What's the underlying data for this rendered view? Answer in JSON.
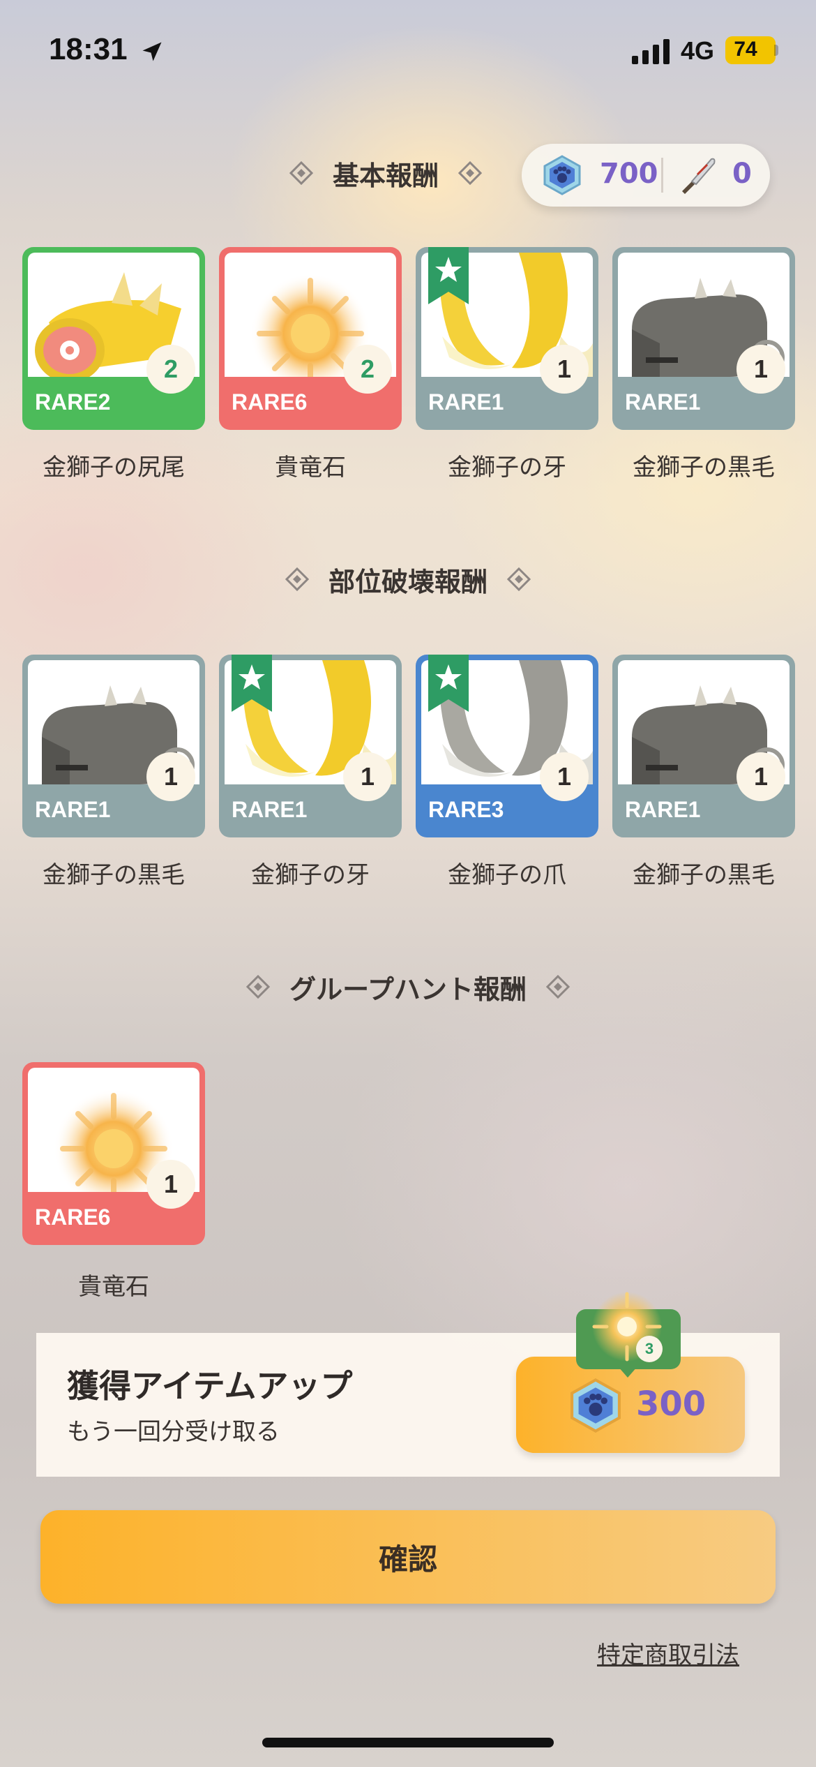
{
  "status_bar": {
    "time": "18:31",
    "network": "4G",
    "battery": "74"
  },
  "currency": {
    "gems": "700",
    "knives": "0"
  },
  "sections": {
    "basic": {
      "title": "基本報酬"
    },
    "part_break": {
      "title": "部位破壊報酬"
    },
    "group_hunt": {
      "title": "グループハント報酬"
    }
  },
  "rewards": {
    "basic": [
      {
        "rarity": "RARE2",
        "count": "2",
        "name": "金獅子の尻尾",
        "color": "#4cbb5a",
        "icon": "tail-icon"
      },
      {
        "rarity": "RARE6",
        "count": "2",
        "name": "貴竜石",
        "color": "#f06e6c",
        "icon": "sun-stone-icon"
      },
      {
        "rarity": "RARE1",
        "count": "1",
        "name": "金獅子の牙",
        "color": "#8fa6a8",
        "icon": "fang-icon"
      },
      {
        "rarity": "RARE1",
        "count": "1",
        "name": "金獅子の黒毛",
        "color": "#8fa6a8",
        "icon": "black-fur-icon"
      }
    ],
    "part_break": [
      {
        "rarity": "RARE1",
        "count": "1",
        "name": "金獅子の黒毛",
        "color": "#8fa6a8",
        "icon": "black-fur-icon"
      },
      {
        "rarity": "RARE1",
        "count": "1",
        "name": "金獅子の牙",
        "color": "#8fa6a8",
        "icon": "fang-icon"
      },
      {
        "rarity": "RARE3",
        "count": "1",
        "name": "金獅子の爪",
        "color": "#4a86cf",
        "icon": "claw-icon"
      },
      {
        "rarity": "RARE1",
        "count": "1",
        "name": "金獅子の黒毛",
        "color": "#8fa6a8",
        "icon": "black-fur-icon"
      }
    ],
    "group_hunt": [
      {
        "rarity": "RARE6",
        "count": "1",
        "name": "貴竜石",
        "color": "#f06e6c",
        "icon": "sun-stone-icon"
      }
    ]
  },
  "bonus": {
    "title": "獲得アイテムアップ",
    "subtitle": "もう一回分受け取る",
    "price": "300",
    "preview_count": "3"
  },
  "confirm_label": "確認",
  "legal_link": "特定商取引法",
  "colors": {
    "accent": "#fdb22a",
    "gem_text": "#7a61c6"
  }
}
